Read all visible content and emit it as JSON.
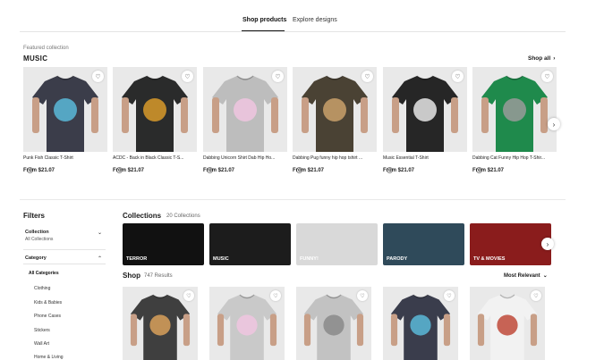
{
  "tabs": {
    "shop_products": "Shop products",
    "explore_designs": "Explore designs"
  },
  "featured": {
    "caption": "Featured collection",
    "title": "MUSIC",
    "shop_all": "Shop all"
  },
  "products": [
    {
      "name": "Punk Fish Classic T-Shirt",
      "price": "From $21.07",
      "shirt": "#3b3d4a"
    },
    {
      "name": "ACDC - Back in Black Classic T-S...",
      "price": "From $21.07",
      "shirt": "#2a2b2b"
    },
    {
      "name": "Dabbing Unicorn Shirt Dab Hip Ho...",
      "price": "From $21.07",
      "shirt": "#bdbdbd"
    },
    {
      "name": "Dabbing Pug funny hip hop tshirt ...",
      "price": "From $21.07",
      "shirt": "#4a4234"
    },
    {
      "name": "Music Essential T-Shirt",
      "price": "From $21.07",
      "shirt": "#262626"
    },
    {
      "name": "Dabbing Cat Funny Hip Hop T-Shir...",
      "price": "From $21.07",
      "shirt": "#1f8a4c"
    }
  ],
  "filters": {
    "title": "Filters",
    "collection_label": "Collection",
    "collection_value": "All Collections",
    "category_label": "Category",
    "categories": [
      "All Categories",
      "Clothing",
      "Kids & Babies",
      "Phone Cases",
      "Stickers",
      "Wall Art",
      "Home & Living"
    ]
  },
  "collections": {
    "title": "Collections",
    "count": "20 Collections",
    "items": [
      {
        "label": "TERROR",
        "bg": "#111111"
      },
      {
        "label": "MUSIC",
        "bg": "#1c1c1c"
      },
      {
        "label": "FUNNY!",
        "bg": "#d9d9d9"
      },
      {
        "label": "PARODY",
        "bg": "#2f4a5a"
      },
      {
        "label": "TV & MOVIES",
        "bg": "#8a1c1c"
      }
    ]
  },
  "shop": {
    "title": "Shop",
    "count": "747 Results",
    "sort": "Most Relevant",
    "items": [
      {
        "shirt": "#3f3f3f"
      },
      {
        "shirt": "#c9c9c9"
      },
      {
        "shirt": "#c2c2c2"
      },
      {
        "shirt": "#3a3d4c"
      },
      {
        "shirt": "#f2f2f2"
      }
    ]
  }
}
